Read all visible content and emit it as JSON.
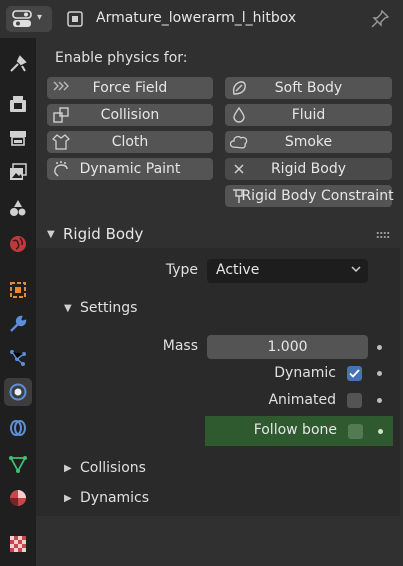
{
  "header": {
    "object_name": "Armature_lowerarm_l_hitbox"
  },
  "physics": {
    "enable_label": "Enable physics for:",
    "buttons": {
      "force_field": "Force Field",
      "soft_body": "Soft Body",
      "collision": "Collision",
      "fluid": "Fluid",
      "cloth": "Cloth",
      "smoke": "Smoke",
      "dynamic_paint": "Dynamic Paint",
      "rigid_body": "Rigid Body",
      "rigid_body_constraint": "Rigid Body Constraint"
    }
  },
  "rigid_body": {
    "title": "Rigid Body",
    "type_label": "Type",
    "type_value": "Active",
    "settings": {
      "title": "Settings",
      "mass_label": "Mass",
      "mass_value": "1.000",
      "dynamic_label": "Dynamic",
      "dynamic_checked": true,
      "animated_label": "Animated",
      "animated_checked": false,
      "follow_bone_label": "Follow bone",
      "follow_bone_checked": false
    },
    "collisions_title": "Collisions",
    "dynamics_title": "Dynamics"
  },
  "colors": {
    "accent": "#4772b3",
    "follow_bone_highlight": "#2f5a2f",
    "panel_bg": "#303030"
  },
  "icons": [
    "editor-type-icon",
    "object-data-icon",
    "pin-icon",
    "tool-icon",
    "render-icon",
    "output-icon",
    "view-layer-icon",
    "scene-icon",
    "world-icon",
    "object-icon",
    "modifier-icon",
    "particles-icon",
    "physics-icon",
    "constraints-icon",
    "object-data-mesh-icon",
    "material-icon",
    "texture-icon"
  ]
}
